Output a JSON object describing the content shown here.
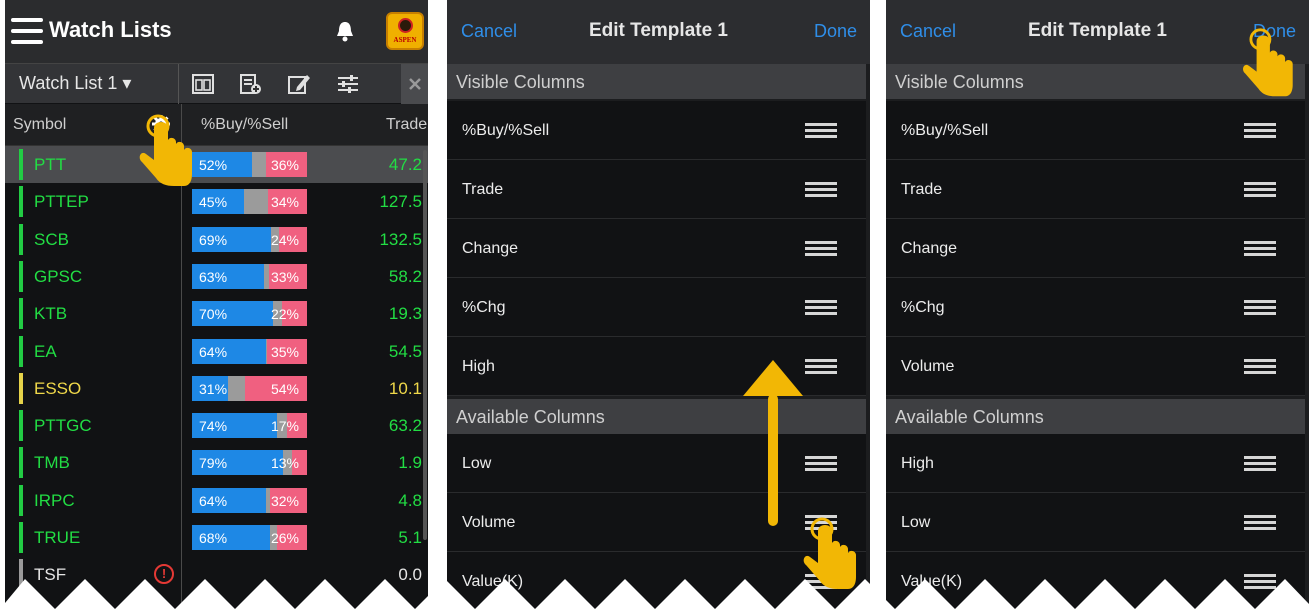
{
  "watchlist": {
    "title": "Watch Lists",
    "selector": "Watch List 1 ▾",
    "columns": {
      "symbol": "Symbol",
      "buy_sell": "%Buy/%Sell",
      "trade": "Trade"
    },
    "logo": "ASPEN",
    "rows": [
      {
        "symbol": "PTT",
        "buy": "52%",
        "sell": "36%",
        "buy_pct": 52,
        "sell_pct": 36,
        "trade": "47.2",
        "marker": "#22cc44",
        "color": "#22dd44",
        "selected": true
      },
      {
        "symbol": "PTTEP",
        "buy": "45%",
        "sell": "34%",
        "buy_pct": 45,
        "sell_pct": 34,
        "trade": "127.5",
        "marker": "#22cc44",
        "color": "#22dd44"
      },
      {
        "symbol": "SCB",
        "buy": "69%",
        "sell": "24%",
        "buy_pct": 69,
        "sell_pct": 24,
        "trade": "132.5",
        "marker": "#22cc44",
        "color": "#22dd44"
      },
      {
        "symbol": "GPSC",
        "buy": "63%",
        "sell": "33%",
        "buy_pct": 63,
        "sell_pct": 33,
        "trade": "58.2",
        "marker": "#22cc44",
        "color": "#22dd44"
      },
      {
        "symbol": "KTB",
        "buy": "70%",
        "sell": "22%",
        "buy_pct": 70,
        "sell_pct": 22,
        "trade": "19.3",
        "marker": "#22cc44",
        "color": "#22dd44"
      },
      {
        "symbol": "EA",
        "buy": "64%",
        "sell": "35%",
        "buy_pct": 64,
        "sell_pct": 35,
        "trade": "54.5",
        "marker": "#22cc44",
        "color": "#22dd44"
      },
      {
        "symbol": "ESSO",
        "buy": "31%",
        "sell": "54%",
        "buy_pct": 31,
        "sell_pct": 54,
        "trade": "10.1",
        "marker": "#e6d34a",
        "color": "#f0d84a"
      },
      {
        "symbol": "PTTGC",
        "buy": "74%",
        "sell": "17%",
        "buy_pct": 74,
        "sell_pct": 17,
        "trade": "63.2",
        "marker": "#22cc44",
        "color": "#22dd44"
      },
      {
        "symbol": "TMB",
        "buy": "79%",
        "sell": "13%",
        "buy_pct": 79,
        "sell_pct": 13,
        "trade": "1.9",
        "marker": "#22cc44",
        "color": "#22dd44"
      },
      {
        "symbol": "IRPC",
        "buy": "64%",
        "sell": "32%",
        "buy_pct": 64,
        "sell_pct": 32,
        "trade": "4.8",
        "marker": "#22cc44",
        "color": "#22dd44"
      },
      {
        "symbol": "TRUE",
        "buy": "68%",
        "sell": "26%",
        "buy_pct": 68,
        "sell_pct": 26,
        "trade": "5.1",
        "marker": "#22cc44",
        "color": "#22dd44"
      },
      {
        "symbol": "TSF",
        "buy": "",
        "sell": "",
        "buy_pct": 0,
        "sell_pct": 0,
        "trade": "0.0",
        "marker": "#9a9a9a",
        "color": "#e6e6e6",
        "alert": "!"
      }
    ]
  },
  "edit_before": {
    "cancel": "Cancel",
    "title": "Edit Template 1",
    "done": "Done",
    "visible_header": "Visible Columns",
    "visible": [
      "%Buy/%Sell",
      "Trade",
      "Change",
      "%Chg",
      "High"
    ],
    "available_header": "Available Columns",
    "available": [
      "Low",
      "Volume",
      "Value(K)"
    ]
  },
  "edit_after": {
    "cancel": "Cancel",
    "title": "Edit Template 1",
    "done": "Done",
    "visible_header": "Visible Columns",
    "visible": [
      "%Buy/%Sell",
      "Trade",
      "Change",
      "%Chg",
      "Volume"
    ],
    "available_header": "Available Columns",
    "available": [
      "High",
      "Low",
      "Value(K)"
    ]
  },
  "colors": {
    "accent": "#2f8ee8",
    "buy": "#1e88e5",
    "sell": "#f06080",
    "gesture": "#f2b705"
  }
}
